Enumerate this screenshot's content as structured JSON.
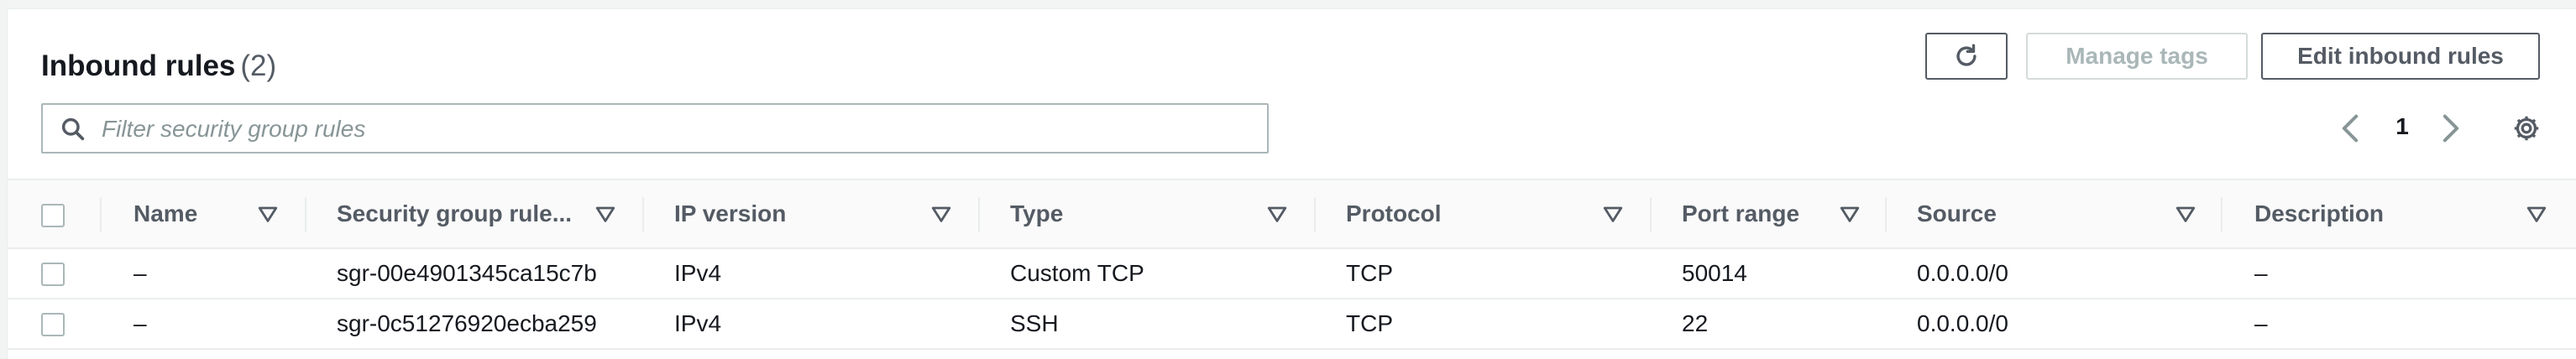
{
  "header": {
    "title": "Inbound rules",
    "count": "(2)"
  },
  "toolbar": {
    "refresh_icon": "refresh-icon",
    "manage_tags_label": "Manage tags",
    "edit_inbound_label": "Edit inbound rules"
  },
  "filter": {
    "placeholder": "Filter security group rules",
    "value": "",
    "icon": "search-icon"
  },
  "pagination": {
    "page": "1",
    "prev_icon": "chevron-left-icon",
    "next_icon": "chevron-right-icon",
    "settings_icon": "gear-icon"
  },
  "table": {
    "columns": [
      {
        "key": "name",
        "label": "Name"
      },
      {
        "key": "rule_id",
        "label": "Security group rule..."
      },
      {
        "key": "ip_version",
        "label": "IP version"
      },
      {
        "key": "type",
        "label": "Type"
      },
      {
        "key": "protocol",
        "label": "Protocol"
      },
      {
        "key": "port_range",
        "label": "Port range"
      },
      {
        "key": "source",
        "label": "Source"
      },
      {
        "key": "description",
        "label": "Description"
      }
    ],
    "rows": [
      {
        "name": "–",
        "rule_id": "sgr-00e4901345ca15c7b",
        "ip_version": "IPv4",
        "type": "Custom TCP",
        "protocol": "TCP",
        "port_range": "50014",
        "source": "0.0.0.0/0",
        "description": "–"
      },
      {
        "name": "–",
        "rule_id": "sgr-0c51276920ecba259",
        "ip_version": "IPv4",
        "type": "SSH",
        "protocol": "TCP",
        "port_range": "22",
        "source": "0.0.0.0/0",
        "description": "–"
      }
    ]
  },
  "colors": {
    "text": "#16191f",
    "muted": "#545b64",
    "disabled": "#aab7b8",
    "border": "#eaeded",
    "page_bg": "#f2f3f3"
  }
}
